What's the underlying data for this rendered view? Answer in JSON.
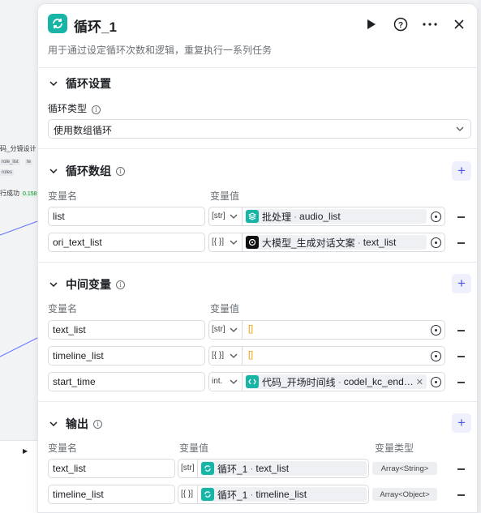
{
  "canvas": {
    "node_title": "码_分镜设计",
    "chips": [
      "role_list",
      "te",
      "roles"
    ],
    "run_status": "行成功",
    "run_badge": "0.158"
  },
  "header": {
    "title": "循环_1",
    "description": "用于通过设定循环次数和逻辑，重复执行一系列任务"
  },
  "loop_settings": {
    "title": "循环设置",
    "type_label": "循环类型",
    "type_value": "使用数组循环"
  },
  "loop_array": {
    "title": "循环数组",
    "col_name": "变量名",
    "col_value": "变量值",
    "rows": [
      {
        "name": "list",
        "type": "[str]",
        "node": "批处理",
        "var": "audio_list",
        "icon": "layers-icon",
        "icon_color": "#18b4a6"
      },
      {
        "name": "ori_text_list",
        "type": "[{ }]",
        "node": "大模型_生成对话文案",
        "var": "text_list",
        "icon": "llm-icon",
        "icon_color": "#111111"
      }
    ]
  },
  "intermediate": {
    "title": "中间变量",
    "col_name": "变量名",
    "col_value": "变量值",
    "rows": [
      {
        "name": "text_list",
        "type": "[str]",
        "value": "[]"
      },
      {
        "name": "timeline_list",
        "type": "[{ }]",
        "value": "[]"
      },
      {
        "name": "start_time",
        "type": "int.",
        "node": "代码_开场时间线",
        "var": "codel_kc_end…",
        "icon": "code-icon",
        "icon_color": "#18b4a6"
      }
    ]
  },
  "output": {
    "title": "输出",
    "col_name": "变量名",
    "col_value": "变量值",
    "col_type": "变量类型",
    "rows": [
      {
        "name": "text_list",
        "type": "[str]",
        "node": "循环_1",
        "var": "text_list",
        "data_type": "Array<String>"
      },
      {
        "name": "timeline_list",
        "type": "[{ }]",
        "node": "循环_1",
        "var": "timeline_list",
        "data_type": "Array<Object>"
      }
    ]
  },
  "colors": {
    "accent": "#4d53e8",
    "loop_icon": "#18b4a6",
    "empty_value": "#e8a200"
  }
}
